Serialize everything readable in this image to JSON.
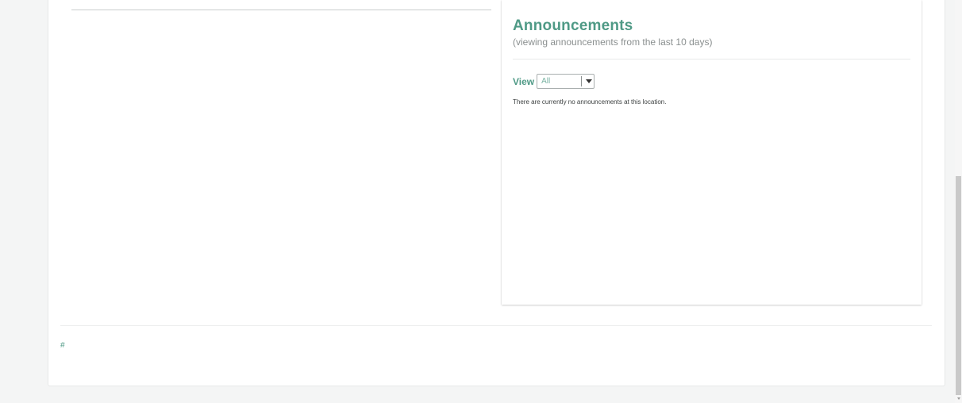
{
  "announcements": {
    "title": "Announcements",
    "subtitle": "(viewing announcements from the last 10 days)",
    "view_label": "View",
    "view_selected": "All",
    "empty_message": "There are currently no announcements at this location."
  },
  "footer": {
    "link_text": "#"
  },
  "colors": {
    "accent": "#4f9a86",
    "muted_text": "#8a8f8f",
    "body_text": "#3b3f3f",
    "page_background": "#f4f5f5"
  },
  "icons": {
    "select_arrow": "chevron-down-icon"
  }
}
